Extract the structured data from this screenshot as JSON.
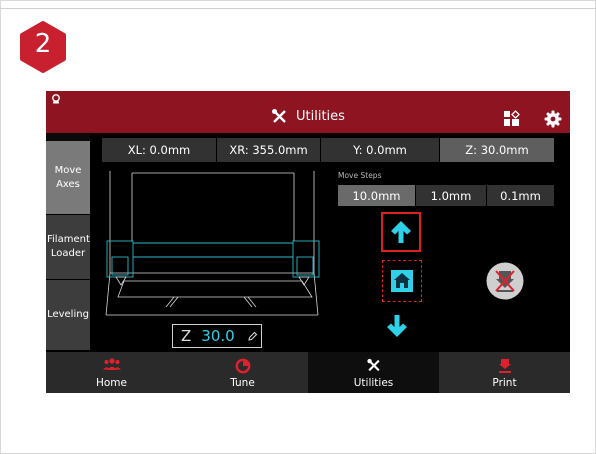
{
  "step": {
    "number": "2",
    "color": "#c8202f"
  },
  "header": {
    "title": "Utilities",
    "icons": [
      "printer-status-icon",
      "wrench-screwdriver-icon",
      "layout-icon",
      "gear-icon"
    ],
    "color": "#8e1421"
  },
  "sidebar": {
    "items": [
      {
        "label": "Move Axes",
        "active": true
      },
      {
        "label": "Filament Loader",
        "active": false
      },
      {
        "label": "Leveling",
        "active": false
      }
    ]
  },
  "coords": {
    "xl": "XL: 0.0mm",
    "xr": "XR: 355.0mm",
    "y": "Y: 0.0mm",
    "z": "Z: 30.0mm"
  },
  "move_steps": {
    "label": "Move Steps",
    "options": [
      "10.0mm",
      "1.0mm",
      "0.1mm"
    ],
    "selected": "10.0mm"
  },
  "z_input": {
    "label": "Z",
    "value": "30.0"
  },
  "controls": {
    "up_icon": "arrow-up-icon",
    "home_icon": "home-icon",
    "down_icon": "arrow-down-icon",
    "disable_icon": "disable-motors-icon"
  },
  "tabs": [
    {
      "label": "Home",
      "icon": "users-icon",
      "active": false
    },
    {
      "label": "Tune",
      "icon": "tune-icon",
      "active": false
    },
    {
      "label": "Utilities",
      "icon": "wrench-screwdriver-icon",
      "active": true
    },
    {
      "label": "Print",
      "icon": "print-icon",
      "active": false
    }
  ],
  "colors": {
    "accent": "#e0202f",
    "cyan": "#2fd0e8",
    "highlight_box": "#d92121"
  }
}
